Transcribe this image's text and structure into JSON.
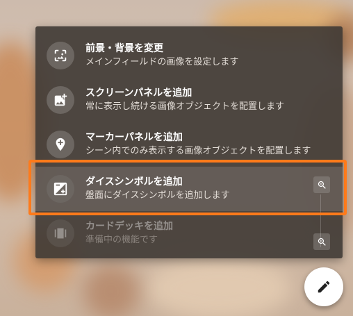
{
  "menu": {
    "items": [
      {
        "title": "前景・背景を変更",
        "subtitle": "メインフィールドの画像を設定します",
        "icon": "image-frame-icon",
        "enabled": true
      },
      {
        "title": "スクリーンパネルを追加",
        "subtitle": "常に表示し続ける画像オブジェクトを配置します",
        "icon": "add-photo-icon",
        "enabled": true
      },
      {
        "title": "マーカーパネルを追加",
        "subtitle": "シーン内でのみ表示する画像オブジェクトを配置します",
        "icon": "add-location-icon",
        "enabled": true
      },
      {
        "title": "ダイスシンボルを追加",
        "subtitle": "盤面にダイスシンボルを追加します",
        "icon": "exposure-icon",
        "enabled": true
      },
      {
        "title": "カードデッキを追加",
        "subtitle": "準備中の機能です",
        "icon": "card-deck-icon",
        "enabled": false
      }
    ]
  },
  "highlight_color": "#ff7a1a",
  "fab_icon": "pencil-icon"
}
